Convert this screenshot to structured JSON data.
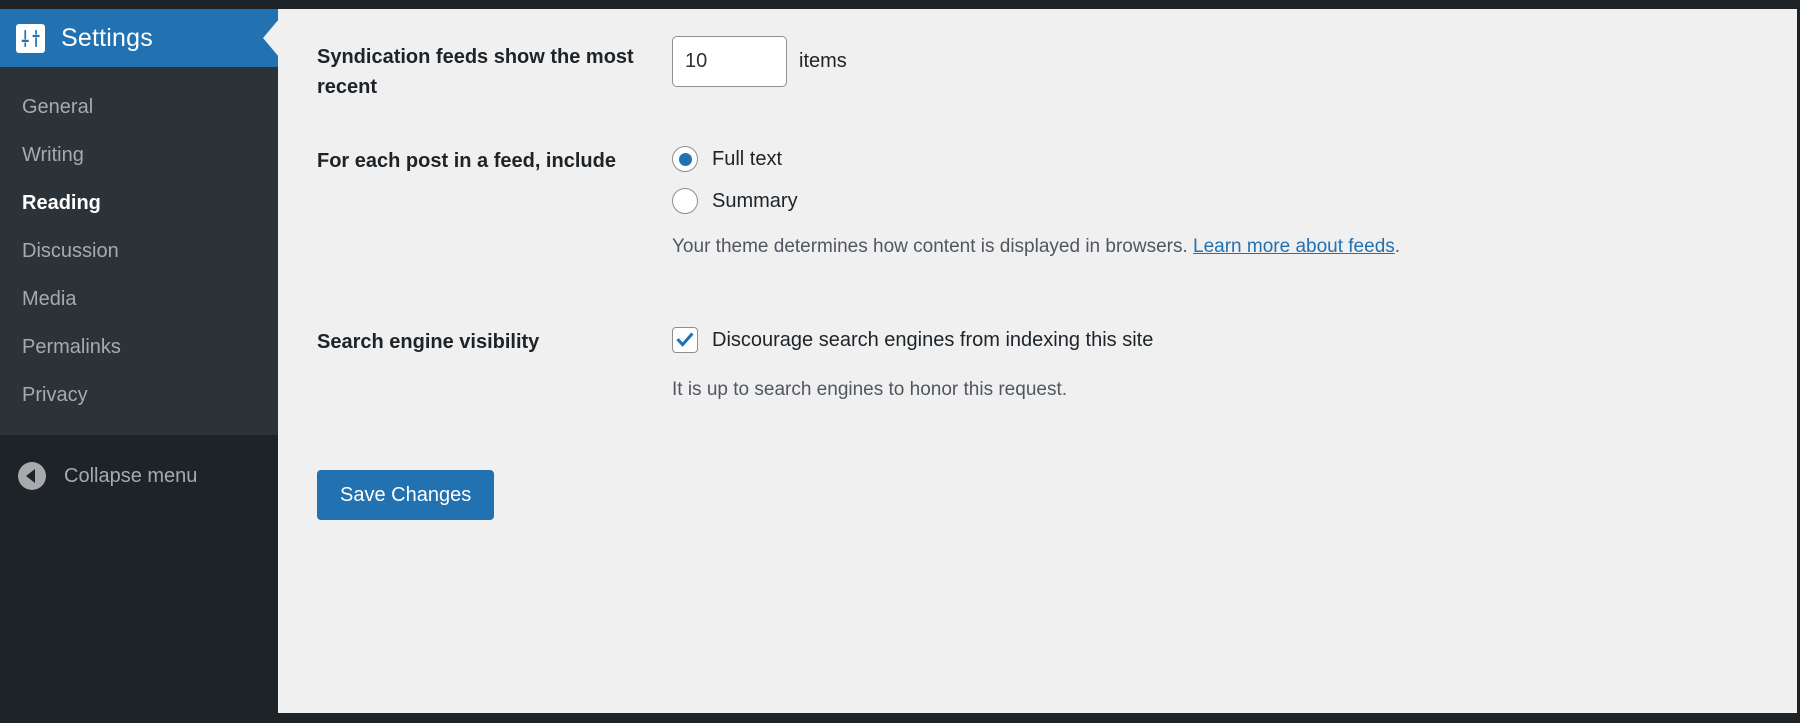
{
  "sidebar": {
    "header": {
      "label": "Settings",
      "icon": "settings-sliders-icon"
    },
    "items": [
      {
        "label": "General",
        "active": false
      },
      {
        "label": "Writing",
        "active": false
      },
      {
        "label": "Reading",
        "active": true
      },
      {
        "label": "Discussion",
        "active": false
      },
      {
        "label": "Media",
        "active": false
      },
      {
        "label": "Permalinks",
        "active": false
      },
      {
        "label": "Privacy",
        "active": false
      }
    ],
    "collapse": {
      "label": "Collapse menu",
      "icon": "collapse-left-arrow-icon"
    }
  },
  "main": {
    "rows": {
      "syndication": {
        "label": "Syndication feeds show the most recent",
        "value": "10",
        "suffix": "items"
      },
      "feed_include": {
        "label": "For each post in a feed, include",
        "options": [
          {
            "label": "Full text",
            "selected": true
          },
          {
            "label": "Summary",
            "selected": false
          }
        ],
        "help_prefix": "Your theme determines how content is displayed in browsers. ",
        "help_link": "Learn more about feeds",
        "help_suffix": "."
      },
      "search_visibility": {
        "label": "Search engine visibility",
        "checkbox_label": "Discourage search engines from indexing this site",
        "checked": true,
        "help": "It is up to search engines to honor this request."
      }
    },
    "submit": {
      "label": "Save Changes"
    }
  },
  "colors": {
    "sidebar_bg": "#1d2327",
    "submenu_bg": "#2c3338",
    "accent_blue": "#2271b1",
    "content_bg": "#f0f0f1",
    "muted_text": "#50575e",
    "menu_text": "#a7aaad"
  }
}
